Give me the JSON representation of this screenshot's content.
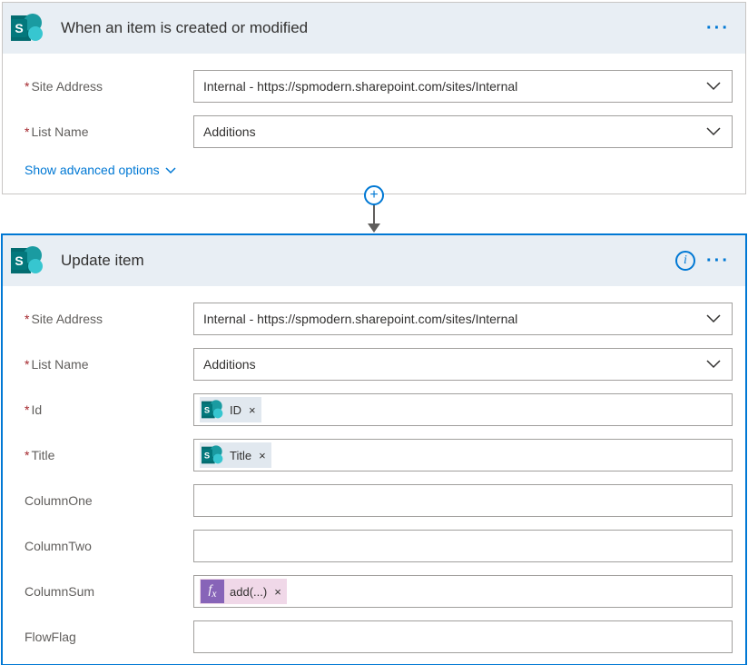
{
  "trigger": {
    "title": "When an item is created or modified",
    "site_address_label": "Site Address",
    "site_address_value": "Internal - https://spmodern.sharepoint.com/sites/Internal",
    "list_name_label": "List Name",
    "list_name_value": "Additions",
    "advanced_link": "Show advanced options"
  },
  "action": {
    "title": "Update item",
    "site_address_label": "Site Address",
    "site_address_value": "Internal - https://spmodern.sharepoint.com/sites/Internal",
    "list_name_label": "List Name",
    "list_name_value": "Additions",
    "id_label": "Id",
    "id_token": "ID",
    "title_label": "Title",
    "title_token": "Title",
    "col1_label": "ColumnOne",
    "col2_label": "ColumnTwo",
    "colsum_label": "ColumnSum",
    "colsum_token": "add(...)",
    "flowflag_label": "FlowFlag"
  }
}
